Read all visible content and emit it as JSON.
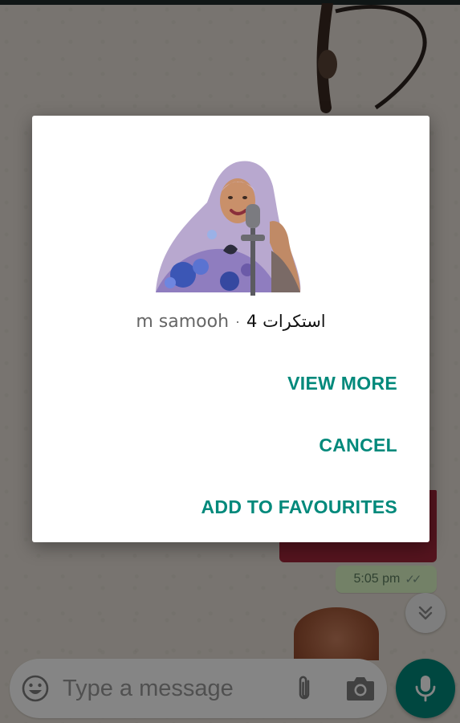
{
  "dialog": {
    "pack_author": "m samooh",
    "separator": "·",
    "pack_count": "استكرات 4",
    "actions": {
      "view_more": "VIEW MORE",
      "cancel": "CANCEL",
      "add_to_favourites": "ADD TO FAVOURITES"
    }
  },
  "chat": {
    "message_time": "5:05 pm",
    "message_status_icon": "double-check-icon"
  },
  "input_bar": {
    "placeholder": "Type a message",
    "icons": [
      "emoji-icon",
      "attach-icon",
      "camera-icon",
      "mic-icon"
    ]
  },
  "colors": {
    "accent": "#00897b",
    "bubble_out": "#dcf8c6",
    "dialog_bg": "#ffffff"
  }
}
